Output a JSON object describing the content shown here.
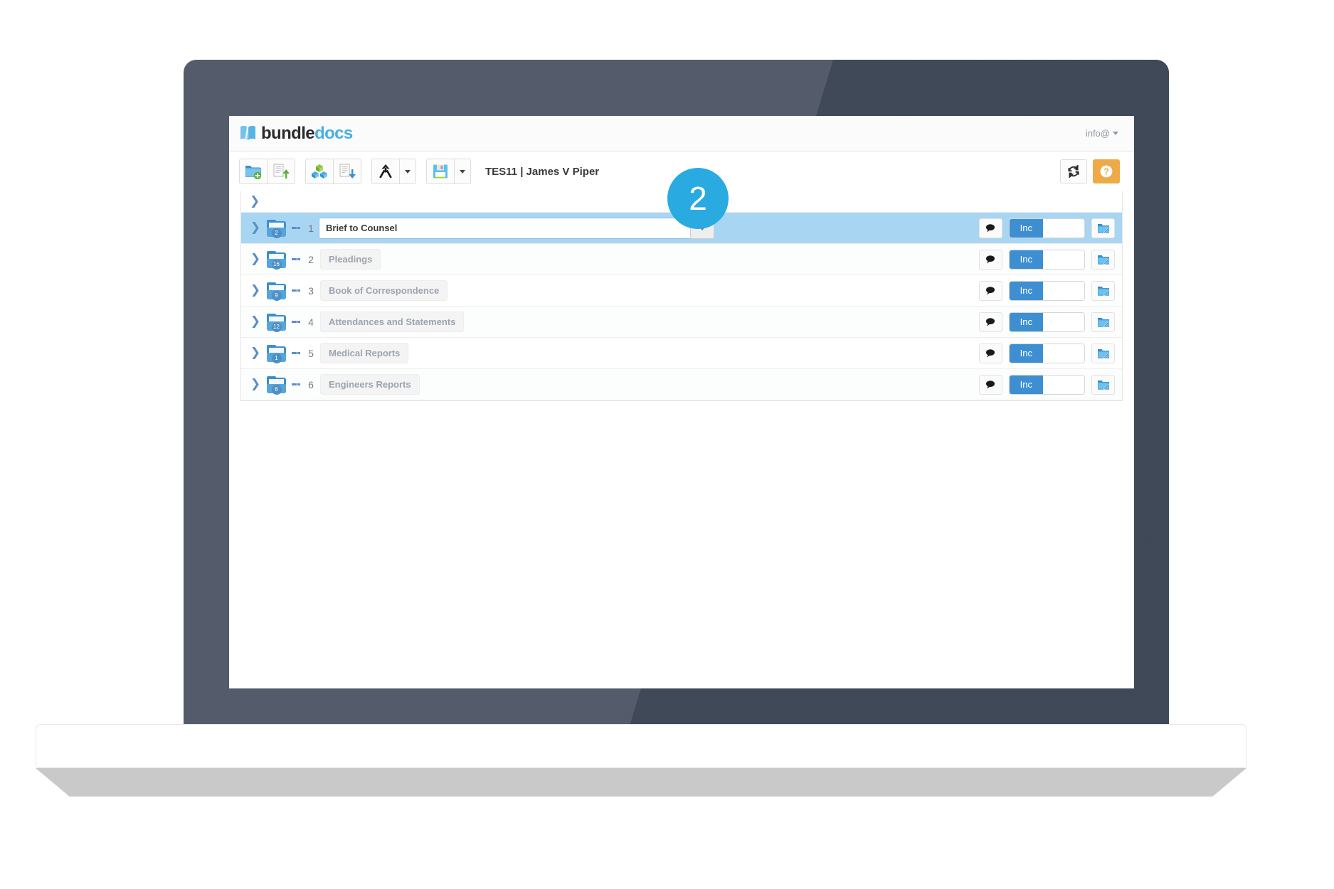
{
  "app": {
    "logo_primary": "bundle",
    "logo_secondary": "docs",
    "logo_icon": "book-icon",
    "user_menu_label": "info@"
  },
  "toolbar": {
    "groups": [
      {
        "buttons": [
          {
            "name": "new-folder-button",
            "icon": "folder-add-icon",
            "label": ""
          },
          {
            "name": "upload-document-button",
            "icon": "document-upload-icon",
            "label": ""
          }
        ]
      },
      {
        "buttons": [
          {
            "name": "sections-button",
            "icon": "cubes-icon",
            "label": ""
          },
          {
            "name": "download-document-button",
            "icon": "document-download-icon",
            "label": ""
          }
        ]
      },
      {
        "buttons": [
          {
            "name": "merge-button",
            "icon": "merge-arrow-icon",
            "label": ""
          },
          {
            "name": "merge-dropdown-button",
            "icon": "caret-down-icon",
            "label": ""
          }
        ]
      },
      {
        "buttons": [
          {
            "name": "save-button",
            "icon": "floppy-save-icon",
            "label": ""
          },
          {
            "name": "save-dropdown-button",
            "icon": "caret-down-icon",
            "label": ""
          }
        ]
      }
    ],
    "document_title": "TES11 | James V Piper",
    "refresh_label": "refresh-icon",
    "help_label": "?",
    "accent_orange": "#eeaa47",
    "accent_blue": "#3d8fd2"
  },
  "tree": {
    "expand_all_icon": "chevron-right-icon",
    "rows": [
      {
        "index": "1",
        "name": "Brief to Counsel",
        "doc_count": "2",
        "editing": true,
        "include_label": "Inc"
      },
      {
        "index": "2",
        "name": "Pleadings",
        "doc_count": "16",
        "editing": false,
        "include_label": "Inc"
      },
      {
        "index": "3",
        "name": "Book of Correspondence",
        "doc_count": "9",
        "editing": false,
        "include_label": "Inc"
      },
      {
        "index": "4",
        "name": "Attendances and Statements",
        "doc_count": "12",
        "editing": false,
        "include_label": "Inc"
      },
      {
        "index": "5",
        "name": "Medical Reports",
        "doc_count": "1",
        "editing": false,
        "include_label": "Inc"
      },
      {
        "index": "6",
        "name": "Engineers Reports",
        "doc_count": "6",
        "editing": false,
        "include_label": "Inc"
      }
    ]
  },
  "callout": {
    "step_number": "2",
    "color": "#29abe2"
  }
}
